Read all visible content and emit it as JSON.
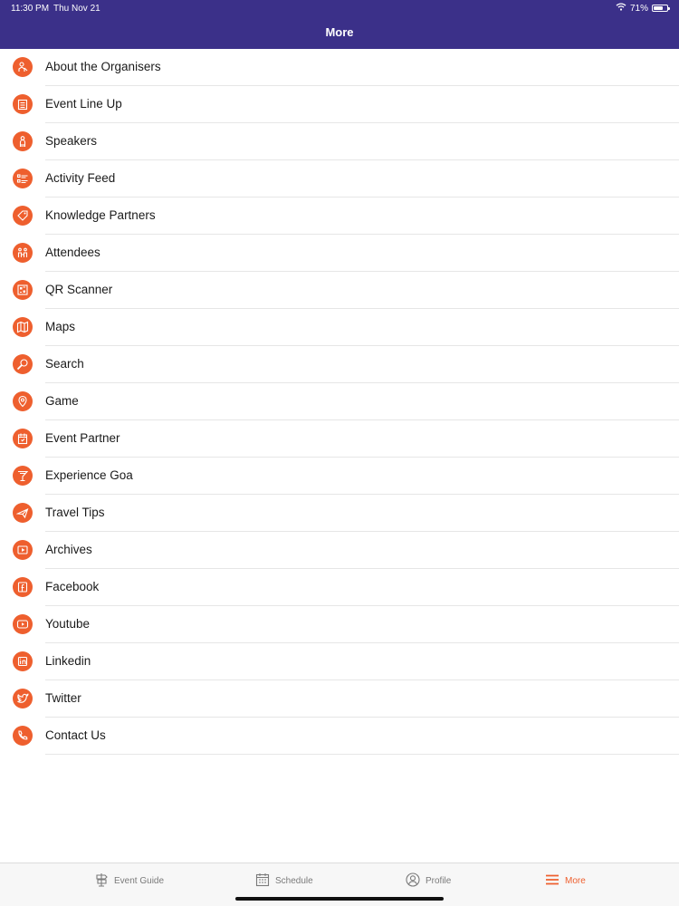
{
  "status": {
    "time": "11:30 PM",
    "date": "Thu Nov 21",
    "battery": "71%",
    "battery_level": 0.71
  },
  "header": {
    "title": "More"
  },
  "colors": {
    "header_bg": "#3b3089",
    "accent": "#ee5f2e"
  },
  "menu": [
    {
      "label": "About the Organisers",
      "icon": "organisers-icon"
    },
    {
      "label": "Event Line Up",
      "icon": "calendar-list-icon"
    },
    {
      "label": "Speakers",
      "icon": "speaker-icon"
    },
    {
      "label": "Activity Feed",
      "icon": "feed-icon"
    },
    {
      "label": "Knowledge Partners",
      "icon": "tag-icon"
    },
    {
      "label": "Attendees",
      "icon": "attendees-icon"
    },
    {
      "label": "QR Scanner",
      "icon": "qr-icon"
    },
    {
      "label": "Maps",
      "icon": "map-icon"
    },
    {
      "label": "Search",
      "icon": "search-icon"
    },
    {
      "label": "Game",
      "icon": "game-icon"
    },
    {
      "label": "Event Partner",
      "icon": "partner-icon"
    },
    {
      "label": "Experience Goa",
      "icon": "cocktail-icon"
    },
    {
      "label": "Travel Tips",
      "icon": "plane-icon"
    },
    {
      "label": "Archives",
      "icon": "play-icon"
    },
    {
      "label": "Facebook",
      "icon": "facebook-icon"
    },
    {
      "label": "Youtube",
      "icon": "youtube-icon"
    },
    {
      "label": "Linkedin",
      "icon": "linkedin-icon"
    },
    {
      "label": "Twitter",
      "icon": "twitter-icon"
    },
    {
      "label": "Contact Us",
      "icon": "phone-icon"
    }
  ],
  "tabs": [
    {
      "label": "Event Guide",
      "icon": "signpost-icon",
      "active": false
    },
    {
      "label": "Schedule",
      "icon": "calendar-icon",
      "active": false
    },
    {
      "label": "Profile",
      "icon": "profile-icon",
      "active": false
    },
    {
      "label": "More",
      "icon": "menu-icon",
      "active": true
    }
  ]
}
